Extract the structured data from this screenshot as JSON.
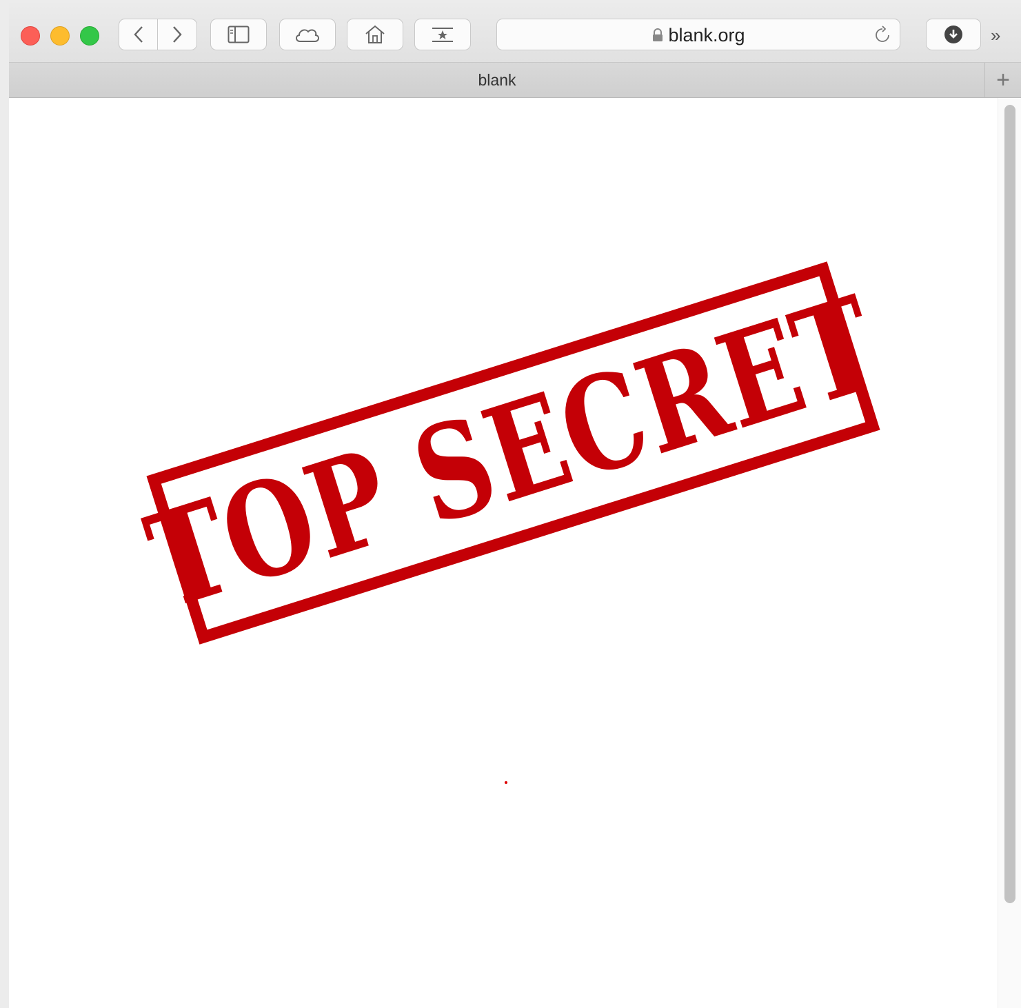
{
  "browser": {
    "address": {
      "url": "blank.org"
    },
    "tab": {
      "title": "blank",
      "new_tab_label": "+"
    },
    "toolbar": {
      "overflow_label": "»"
    },
    "icons": [
      "back-icon",
      "forward-icon",
      "sidebar-icon",
      "cloud-icon",
      "home-icon",
      "bookmark-icon",
      "lock-icon",
      "reload-icon",
      "download-icon"
    ]
  },
  "page": {
    "stamp_text": "TOP SECRET",
    "colors": {
      "stamp": "#c40006",
      "close": "#fc5f57",
      "minimize": "#fdbc2e",
      "zoom": "#33c748"
    }
  }
}
